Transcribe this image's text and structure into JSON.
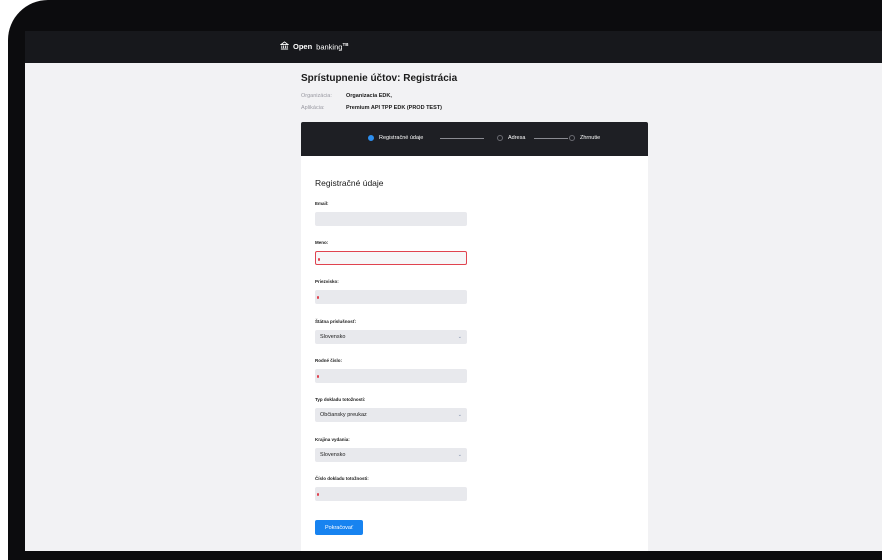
{
  "header": {
    "brand_bold": "Open",
    "brand_rest": "banking",
    "brand_tm": "TB"
  },
  "page": {
    "title": "Sprístupnenie účtov: Registrácia",
    "org_label": "Organizácia:",
    "org_value": "Organizacia EDK,",
    "app_label": "Aplikácia:",
    "app_value": "Premium API TPP EDK (PROD TEST)"
  },
  "stepper": {
    "steps": [
      {
        "label": "Registračné údaje",
        "active": true
      },
      {
        "label": "Adresa",
        "active": false
      },
      {
        "label": "Zhrnutie",
        "active": false
      }
    ]
  },
  "form": {
    "heading": "Registračné údaje",
    "fields": [
      {
        "label": "Email:",
        "value": ""
      },
      {
        "label": "Meno:",
        "value": ""
      },
      {
        "label": "Priezvisko:",
        "value": ""
      },
      {
        "label": "Štátna príslušnosť:",
        "value": "Slovensko"
      },
      {
        "label": "Rodné číslo:",
        "value": ""
      },
      {
        "label": "Typ dokladu totožnosti:",
        "value": "Občiansky preukaz"
      },
      {
        "label": "Krajina vydania:",
        "value": "Slovensko"
      },
      {
        "label": "Číslo dokladu totožnosti:",
        "value": ""
      }
    ],
    "submit_label": "Pokračovať"
  },
  "colors": {
    "accent": "#1783f0",
    "error": "#e0434f",
    "header_bg": "#17181c"
  }
}
